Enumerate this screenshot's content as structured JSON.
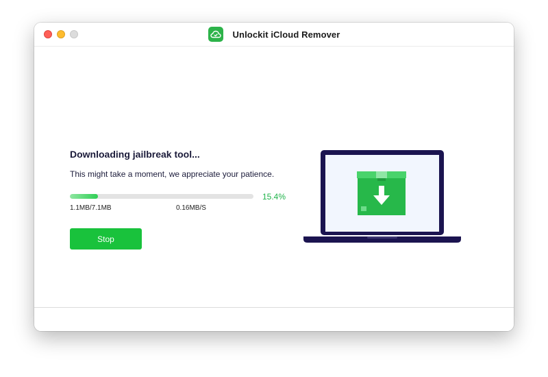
{
  "window": {
    "title": "Unlockit iCloud Remover"
  },
  "download": {
    "heading": "Downloading jailbreak tool...",
    "message": "This might take a moment, we appreciate your patience.",
    "progress_fraction": 0.154,
    "progress_label": "15.4%",
    "size_label": "1.1MB/7.1MB",
    "speed_label": "0.16MB/S",
    "stop_label": "Stop"
  },
  "icons": {
    "app": "cloud-icon",
    "illustration": "laptop-download-box-icon"
  },
  "colors": {
    "accent_green": "#19c23c",
    "percent_green": "#1fb34a",
    "laptop_frame": "#1b1450",
    "box_green": "#27b84a"
  }
}
